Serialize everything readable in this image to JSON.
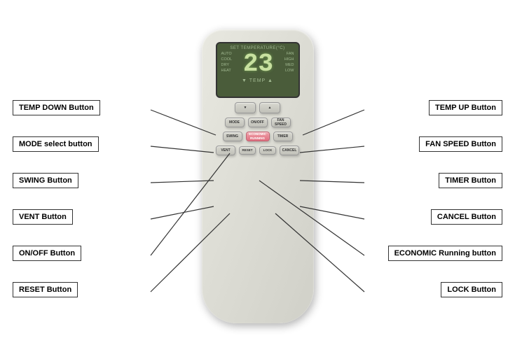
{
  "display": {
    "title": "SET TEMPERATURE(°C)",
    "temp_value": "23",
    "left_labels": [
      "AUTO",
      "COOL",
      "DRY",
      "HEAT"
    ],
    "right_labels": [
      "FAN",
      "HIGH",
      "MED",
      "LOW"
    ],
    "temp_label": "▼ TEMP ▲"
  },
  "buttons": {
    "temp_down": "▼",
    "temp_up": "▲",
    "mode": "MODE",
    "onoff": "ON/OFF",
    "fan_speed": "FAN\nSPEED",
    "swing": "SWING",
    "economic": "ECONOMIC\nRUNNING",
    "timer": "TIMER",
    "vent": "VENT",
    "reset": "RESET",
    "lock": "LOCK",
    "cancel": "CANCEL"
  },
  "labels": {
    "temp_down": "TEMP DOWN Button",
    "temp_up": "TEMP UP Button",
    "mode_select": "MODE select button",
    "fan_speed": "FAN SPEED Button",
    "swing": "SWING Button",
    "timer": "TIMER Button",
    "vent": "VENT Button",
    "cancel": "CANCEL Button",
    "onoff": "ON/OFF Button",
    "economic": "ECONOMIC Running button",
    "reset": "RESET Button",
    "lock": "LOCK Button"
  }
}
